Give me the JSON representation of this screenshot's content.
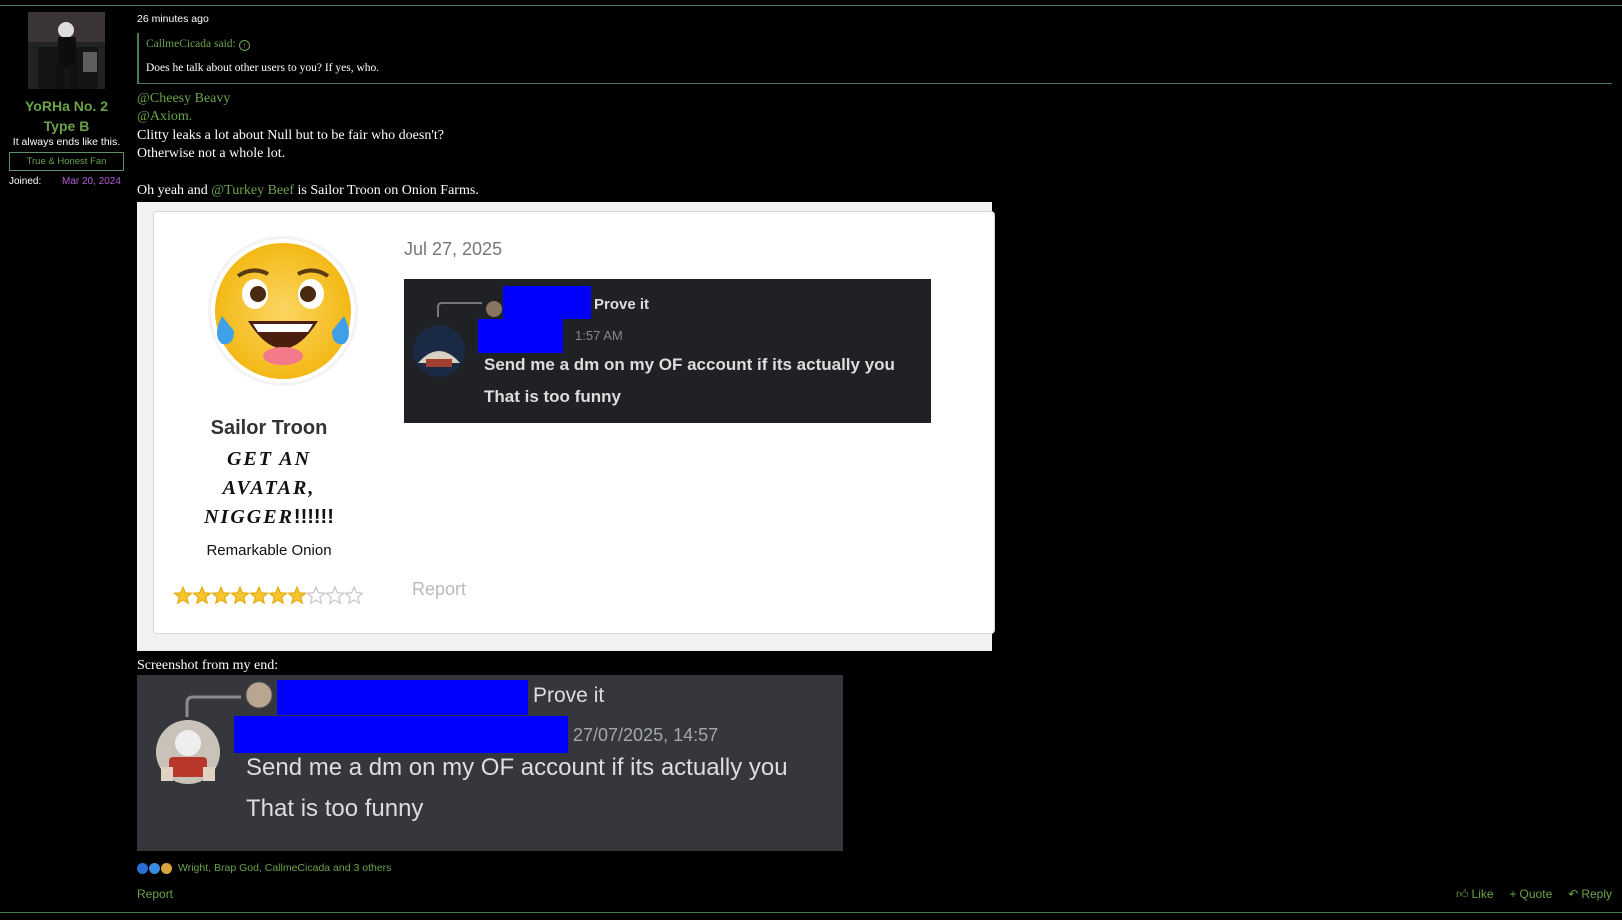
{
  "user": {
    "name_line1": "YoRHa No. 2",
    "name_line2": "Type B",
    "tagline": "It always ends like this.",
    "banner": "True & Honest Fan",
    "joined_label": "Joined:",
    "joined_date": "Mar 20, 2024"
  },
  "post": {
    "timestamp": "26 minutes ago",
    "quote": {
      "author": "CallmeCicada said:",
      "text": "Does he talk about other users to you? If yes, who."
    },
    "mention1": "@Cheesy Beavy",
    "mention2": "@Axiom.",
    "line1": "Clitty leaks a lot about Null but to be fair who doesn't?",
    "line2": "Otherwise not a whole lot.",
    "line3_prefix": "Oh yeah and ",
    "line3_mention": "@Turkey Beef",
    "line3_suffix": " is Sailor Troon on Onion Farms.",
    "caption2": "Screenshot from my end:"
  },
  "screenshot1": {
    "username": "Sailor Troon",
    "custom_title_parts": [
      "GET AN",
      "AVATAR,",
      "NIGGER",
      "!!!!!!"
    ],
    "rank": "Remarkable Onion",
    "rating": 7,
    "rating_max": 10,
    "date": "Jul 27, 2025",
    "report": "Report",
    "discord": {
      "reply_text": "Prove it",
      "time": "1:57 AM",
      "message1": "Send me a dm on my OF account if its actually you",
      "message2": "That is too funny"
    }
  },
  "screenshot2": {
    "reply_text": "Prove it",
    "time": "27/07/2025, 14:57",
    "message1": "Send me a dm on my OF account if its actually you",
    "message2": "That is too funny"
  },
  "footer": {
    "reactions": "Wright, Brap God, CallmeCicada and 3 others",
    "report": "Report",
    "like": "Like",
    "quote": "Quote",
    "reply": "Reply"
  },
  "colors": {
    "accent_green": "#6aa34a",
    "joined_purple": "#b55bd6",
    "redaction_blue": "#0000ff"
  }
}
